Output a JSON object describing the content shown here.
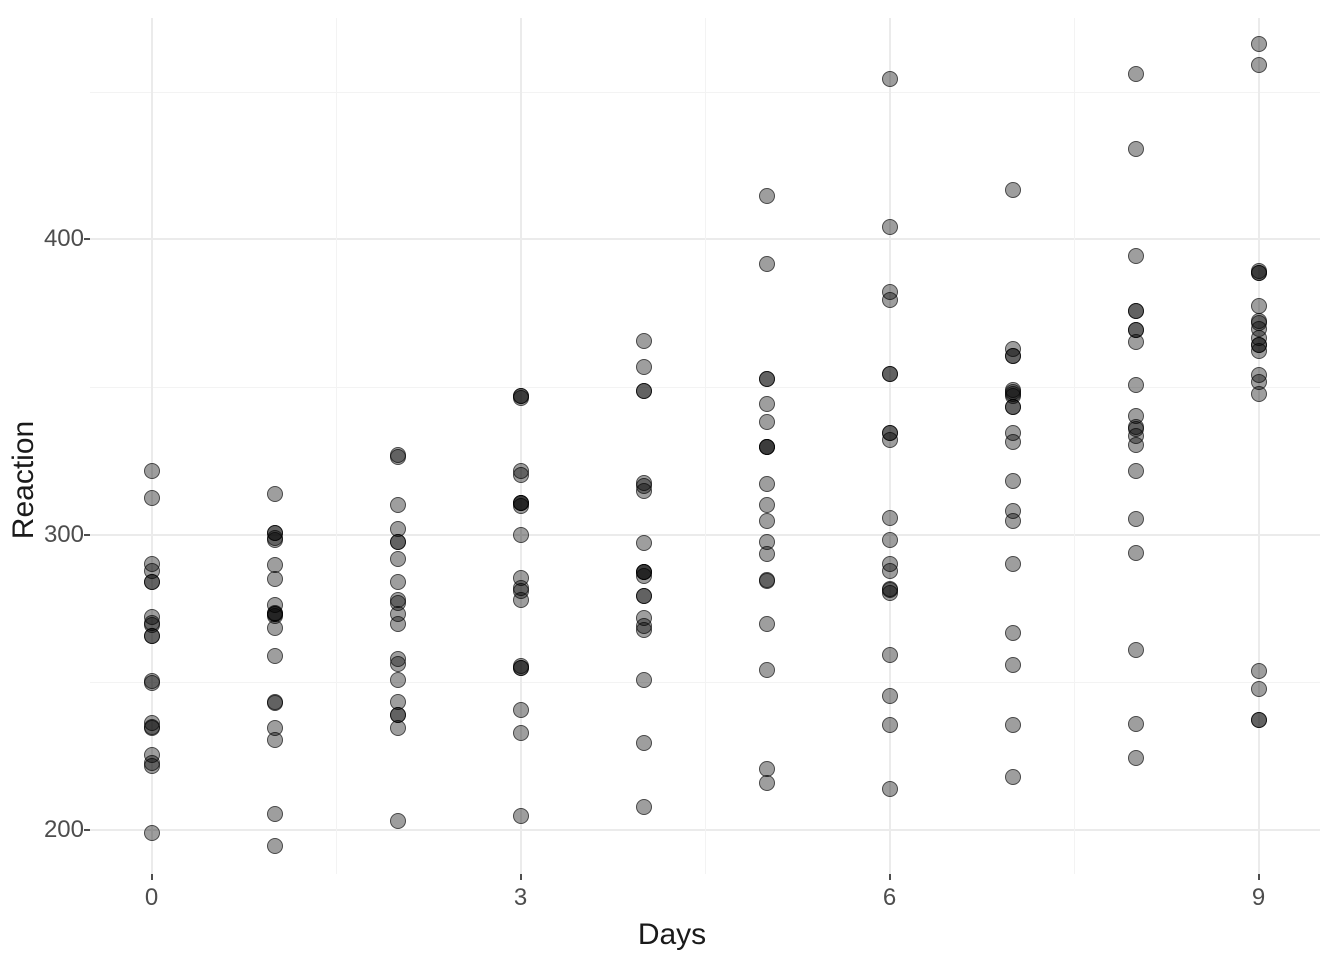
{
  "chart_data": {
    "type": "scatter",
    "title": "",
    "xlabel": "Days",
    "ylabel": "Reaction",
    "xlim": [
      -0.5,
      9.5
    ],
    "ylim": [
      185,
      475
    ],
    "x_ticks": [
      0,
      3,
      6,
      9
    ],
    "y_ticks": [
      200,
      300,
      400
    ],
    "y_minor_ticks": [
      250,
      350,
      450
    ],
    "points": [
      {
        "x": 0,
        "y": 249.56
      },
      {
        "x": 1,
        "y": 258.7
      },
      {
        "x": 2,
        "y": 250.8
      },
      {
        "x": 3,
        "y": 321.44
      },
      {
        "x": 4,
        "y": 356.85
      },
      {
        "x": 5,
        "y": 414.69
      },
      {
        "x": 6,
        "y": 382.2
      },
      {
        "x": 7,
        "y": 290.15
      },
      {
        "x": 8,
        "y": 430.59
      },
      {
        "x": 9,
        "y": 466.35
      },
      {
        "x": 0,
        "y": 222.73
      },
      {
        "x": 1,
        "y": 205.27
      },
      {
        "x": 2,
        "y": 202.98
      },
      {
        "x": 3,
        "y": 204.71
      },
      {
        "x": 4,
        "y": 207.72
      },
      {
        "x": 5,
        "y": 215.96
      },
      {
        "x": 6,
        "y": 213.63
      },
      {
        "x": 7,
        "y": 217.73
      },
      {
        "x": 8,
        "y": 224.3
      },
      {
        "x": 9,
        "y": 237.31
      },
      {
        "x": 0,
        "y": 199.05
      },
      {
        "x": 1,
        "y": 194.33
      },
      {
        "x": 2,
        "y": 234.32
      },
      {
        "x": 3,
        "y": 232.84
      },
      {
        "x": 4,
        "y": 229.31
      },
      {
        "x": 5,
        "y": 220.46
      },
      {
        "x": 6,
        "y": 235.42
      },
      {
        "x": 7,
        "y": 255.75
      },
      {
        "x": 8,
        "y": 261.01
      },
      {
        "x": 9,
        "y": 247.52
      },
      {
        "x": 0,
        "y": 321.54
      },
      {
        "x": 1,
        "y": 300.4
      },
      {
        "x": 2,
        "y": 283.86
      },
      {
        "x": 3,
        "y": 285.13
      },
      {
        "x": 4,
        "y": 285.8
      },
      {
        "x": 5,
        "y": 297.59
      },
      {
        "x": 6,
        "y": 280.24
      },
      {
        "x": 7,
        "y": 318.26
      },
      {
        "x": 8,
        "y": 305.35
      },
      {
        "x": 9,
        "y": 354.05
      },
      {
        "x": 0,
        "y": 287.61
      },
      {
        "x": 1,
        "y": 285
      },
      {
        "x": 2,
        "y": 301.82
      },
      {
        "x": 3,
        "y": 320.12
      },
      {
        "x": 4,
        "y": 316.28
      },
      {
        "x": 5,
        "y": 293.34
      },
      {
        "x": 6,
        "y": 290.08
      },
      {
        "x": 7,
        "y": 334.48
      },
      {
        "x": 8,
        "y": 293.75
      },
      {
        "x": 9,
        "y": 371.58
      },
      {
        "x": 0,
        "y": 234.86
      },
      {
        "x": 1,
        "y": 242.81
      },
      {
        "x": 2,
        "y": 272.96
      },
      {
        "x": 3,
        "y": 309.77
      },
      {
        "x": 4,
        "y": 317.46
      },
      {
        "x": 5,
        "y": 309.95
      },
      {
        "x": 6,
        "y": 454.2
      },
      {
        "x": 7,
        "y": 346.83
      },
      {
        "x": 8,
        "y": 330.3
      },
      {
        "x": 9,
        "y": 253.86
      },
      {
        "x": 0,
        "y": 283.84
      },
      {
        "x": 1,
        "y": 289.56
      },
      {
        "x": 2,
        "y": 276.74
      },
      {
        "x": 3,
        "y": 299.8
      },
      {
        "x": 4,
        "y": 297.17
      },
      {
        "x": 5,
        "y": 338.17
      },
      {
        "x": 6,
        "y": 332.18
      },
      {
        "x": 7,
        "y": 348.84
      },
      {
        "x": 8,
        "y": 333.36
      },
      {
        "x": 9,
        "y": 362.05
      },
      {
        "x": 0,
        "y": 265.47
      },
      {
        "x": 1,
        "y": 276.29
      },
      {
        "x": 2,
        "y": 243.36
      },
      {
        "x": 3,
        "y": 254.67
      },
      {
        "x": 4,
        "y": 279.02
      },
      {
        "x": 5,
        "y": 284.19
      },
      {
        "x": 6,
        "y": 305.53
      },
      {
        "x": 7,
        "y": 331.52
      },
      {
        "x": 8,
        "y": 335.75
      },
      {
        "x": 9,
        "y": 377.3
      },
      {
        "x": 0,
        "y": 290.1
      },
      {
        "x": 1,
        "y": 298.89
      },
      {
        "x": 2,
        "y": 326.14
      },
      {
        "x": 3,
        "y": 346.88
      },
      {
        "x": 4,
        "y": 348.77
      },
      {
        "x": 5,
        "y": 352.82
      },
      {
        "x": 6,
        "y": 354.44
      },
      {
        "x": 7,
        "y": 360.45
      },
      {
        "x": 8,
        "y": 375.74
      },
      {
        "x": 9,
        "y": 388.54
      },
      {
        "x": 0,
        "y": 234.49
      },
      {
        "x": 1,
        "y": 272.92
      },
      {
        "x": 2,
        "y": 309.95
      },
      {
        "x": 3,
        "y": 310.63
      },
      {
        "x": 4,
        "y": 287.17
      },
      {
        "x": 5,
        "y": 329.61
      },
      {
        "x": 6,
        "y": 334.48
      },
      {
        "x": 7,
        "y": 343.22
      },
      {
        "x": 8,
        "y": 369.14
      },
      {
        "x": 9,
        "y": 364.12
      },
      {
        "x": 0,
        "y": 283.97
      },
      {
        "x": 1,
        "y": 273.15
      },
      {
        "x": 2,
        "y": 297.6
      },
      {
        "x": 3,
        "y": 310.63
      },
      {
        "x": 4,
        "y": 287.17
      },
      {
        "x": 5,
        "y": 329.61
      },
      {
        "x": 6,
        "y": 334.48
      },
      {
        "x": 7,
        "y": 343.22
      },
      {
        "x": 8,
        "y": 369.14
      },
      {
        "x": 9,
        "y": 364.12
      },
      {
        "x": 0,
        "y": 265.48
      },
      {
        "x": 1,
        "y": 243.44
      },
      {
        "x": 2,
        "y": 256.2
      },
      {
        "x": 3,
        "y": 255.53
      },
      {
        "x": 4,
        "y": 268.92
      },
      {
        "x": 5,
        "y": 329.73
      },
      {
        "x": 6,
        "y": 379.44
      },
      {
        "x": 7,
        "y": 362.94
      },
      {
        "x": 8,
        "y": 394.49
      },
      {
        "x": 9,
        "y": 389.16
      },
      {
        "x": 0,
        "y": 312.34
      },
      {
        "x": 1,
        "y": 313.8
      },
      {
        "x": 2,
        "y": 291.61
      },
      {
        "x": 3,
        "y": 346.13
      },
      {
        "x": 4,
        "y": 365.73
      },
      {
        "x": 5,
        "y": 391.82
      },
      {
        "x": 6,
        "y": 404.26
      },
      {
        "x": 7,
        "y": 416.69
      },
      {
        "x": 8,
        "y": 455.86
      },
      {
        "x": 9,
        "y": 458.92
      },
      {
        "x": 0,
        "y": 236.11
      },
      {
        "x": 1,
        "y": 230.33
      },
      {
        "x": 2,
        "y": 238.92
      },
      {
        "x": 3,
        "y": 254.92
      },
      {
        "x": 4,
        "y": 250.71
      },
      {
        "x": 5,
        "y": 269.71
      },
      {
        "x": 6,
        "y": 281.56
      },
      {
        "x": 7,
        "y": 308.1
      },
      {
        "x": 8,
        "y": 336.28
      },
      {
        "x": 9,
        "y": 351.64
      },
      {
        "x": 0,
        "y": 250.52
      },
      {
        "x": 1,
        "y": 300.43
      },
      {
        "x": 2,
        "y": 269.76
      },
      {
        "x": 3,
        "y": 280.8
      },
      {
        "x": 4,
        "y": 271.89
      },
      {
        "x": 5,
        "y": 304.63
      },
      {
        "x": 6,
        "y": 287.74
      },
      {
        "x": 7,
        "y": 266.59
      },
      {
        "x": 8,
        "y": 321.54
      },
      {
        "x": 9,
        "y": 347.56
      },
      {
        "x": 0,
        "y": 221.7
      },
      {
        "x": 1,
        "y": 298.19
      },
      {
        "x": 2,
        "y": 326.82
      },
      {
        "x": 3,
        "y": 346.9
      },
      {
        "x": 4,
        "y": 348.72
      },
      {
        "x": 5,
        "y": 352.83
      },
      {
        "x": 6,
        "y": 354.44
      },
      {
        "x": 7,
        "y": 360.44
      },
      {
        "x": 8,
        "y": 375.73
      },
      {
        "x": 9,
        "y": 388.53
      },
      {
        "x": 0,
        "y": 271.91
      },
      {
        "x": 1,
        "y": 268.42
      },
      {
        "x": 2,
        "y": 257.79
      },
      {
        "x": 3,
        "y": 277.66
      },
      {
        "x": 4,
        "y": 314.84
      },
      {
        "x": 5,
        "y": 317.21
      },
      {
        "x": 6,
        "y": 298.11
      },
      {
        "x": 7,
        "y": 348.13
      },
      {
        "x": 8,
        "y": 340.28
      },
      {
        "x": 9,
        "y": 366.51
      },
      {
        "x": 0,
        "y": 225.26
      },
      {
        "x": 1,
        "y": 234.52
      },
      {
        "x": 2,
        "y": 238.9
      },
      {
        "x": 3,
        "y": 240.47
      },
      {
        "x": 4,
        "y": 267.54
      },
      {
        "x": 5,
        "y": 344.39
      },
      {
        "x": 6,
        "y": 281.15
      },
      {
        "x": 7,
        "y": 347.56
      },
      {
        "x": 8,
        "y": 365.16
      },
      {
        "x": 9,
        "y": 372.22
      },
      {
        "x": 0,
        "y": 269.88
      },
      {
        "x": 1,
        "y": 272.4
      },
      {
        "x": 2,
        "y": 277.9
      },
      {
        "x": 3,
        "y": 281.74
      },
      {
        "x": 4,
        "y": 279.12
      },
      {
        "x": 5,
        "y": 284.51
      },
      {
        "x": 6,
        "y": 259.28
      },
      {
        "x": 7,
        "y": 304.63
      },
      {
        "x": 8,
        "y": 350.78
      },
      {
        "x": 9,
        "y": 369.47
      },
      {
        "x": 0,
        "y": 269.41
      },
      {
        "x": 1,
        "y": 273.47
      },
      {
        "x": 2,
        "y": 297.6
      },
      {
        "x": 3,
        "y": 310.63
      },
      {
        "x": 4,
        "y": 287.17
      },
      {
        "x": 5,
        "y": 254.2
      },
      {
        "x": 6,
        "y": 245.33
      },
      {
        "x": 7,
        "y": 235.31
      },
      {
        "x": 8,
        "y": 235.71
      },
      {
        "x": 9,
        "y": 237.16
      }
    ],
    "point_color": "rgba(0,0,0,0.38)",
    "point_border": "rgba(0,0,0,0.55)"
  }
}
